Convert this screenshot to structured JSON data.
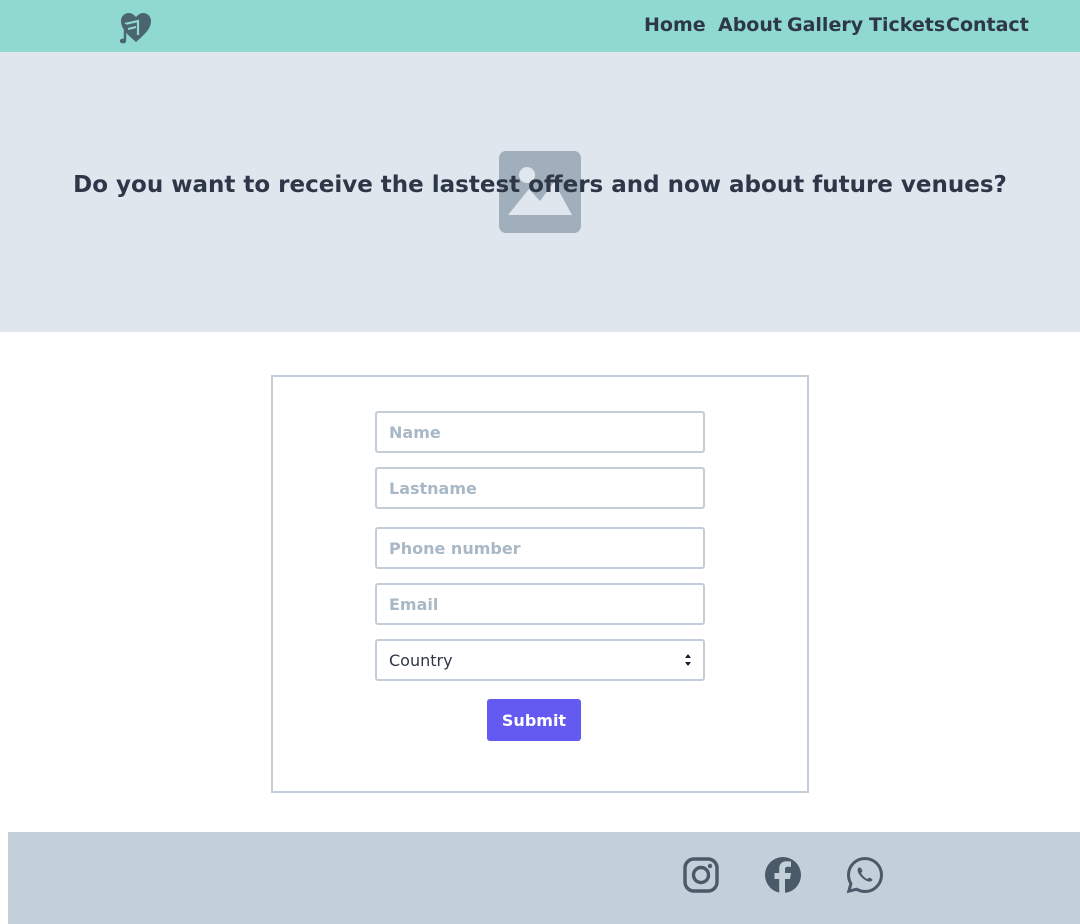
{
  "header": {
    "logo_icon": "music-heart-icon",
    "nav": [
      "Home",
      "About",
      "Gallery",
      "Tickets",
      "Contact"
    ]
  },
  "hero": {
    "title": "Do you want to receive the lastest offers and now about future venues?",
    "image_icon": "image-placeholder-icon"
  },
  "form": {
    "name_placeholder": "Name",
    "lastname_placeholder": "Lastname",
    "phone_placeholder": "Phone number",
    "email_placeholder": "Email",
    "country_selected": "Country",
    "submit_label": "Submit"
  },
  "footer": {
    "social_icons": [
      "instagram-icon",
      "facebook-icon",
      "whatsapp-icon"
    ]
  },
  "colors": {
    "header_bg": "#8fd9d0",
    "hero_bg": "#e0e6ed",
    "footer_bg": "#c3cfd9",
    "accent": "#6459f0",
    "text": "#2d3748"
  }
}
